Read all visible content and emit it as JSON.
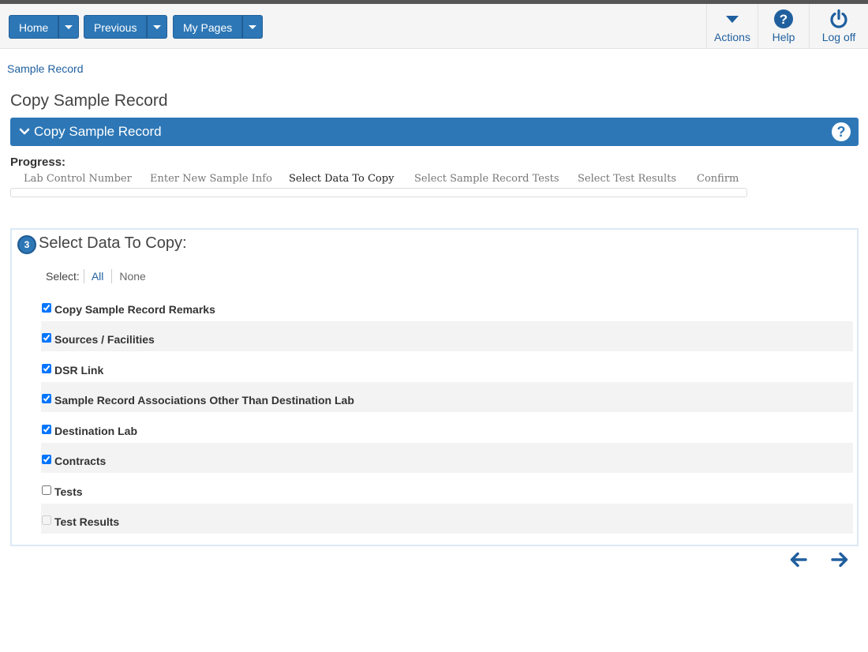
{
  "nav": {
    "home_label": "Home",
    "previous_label": "Previous",
    "mypages_label": "My Pages",
    "actions_label": "Actions",
    "help_label": "Help",
    "logoff_label": "Log off"
  },
  "breadcrumb": "Sample Record",
  "page_title": "Copy Sample Record",
  "panel": {
    "title": "Copy Sample Record"
  },
  "progress": {
    "label": "Progress:",
    "steps": [
      "Lab Control Number",
      "Enter New Sample Info",
      "Select Data To Copy",
      "Select Sample Record Tests",
      "Select Test Results",
      "Confirm"
    ],
    "active_step": "Select Data To Copy"
  },
  "wizard": {
    "step_number": "3",
    "title": "Select Data To Copy:",
    "select_label": "Select:",
    "select_all": "All",
    "select_none": "None",
    "options": [
      {
        "label": "Copy Sample Record Remarks",
        "checked": true,
        "disabled": false
      },
      {
        "label": "Sources / Facilities",
        "checked": true,
        "disabled": false
      },
      {
        "label": "DSR Link",
        "checked": true,
        "disabled": false
      },
      {
        "label": "Sample Record Associations Other Than Destination Lab",
        "checked": true,
        "disabled": false
      },
      {
        "label": "Destination Lab",
        "checked": true,
        "disabled": false
      },
      {
        "label": "Contracts",
        "checked": true,
        "disabled": false
      },
      {
        "label": "Tests",
        "checked": false,
        "disabled": false
      },
      {
        "label": "Test Results",
        "checked": false,
        "disabled": true
      }
    ]
  },
  "icons": {
    "home_caret": "caret-down-icon",
    "actions": "caret-down-icon",
    "help": "question-circle-icon",
    "logoff": "power-icon",
    "panel_toggle": "chevron-down-icon",
    "back": "arrow-left-icon",
    "next": "arrow-right-icon"
  },
  "colors": {
    "primary": "#2d77b6",
    "link": "#1f5f9e",
    "stripe": "#f3f3f3"
  }
}
